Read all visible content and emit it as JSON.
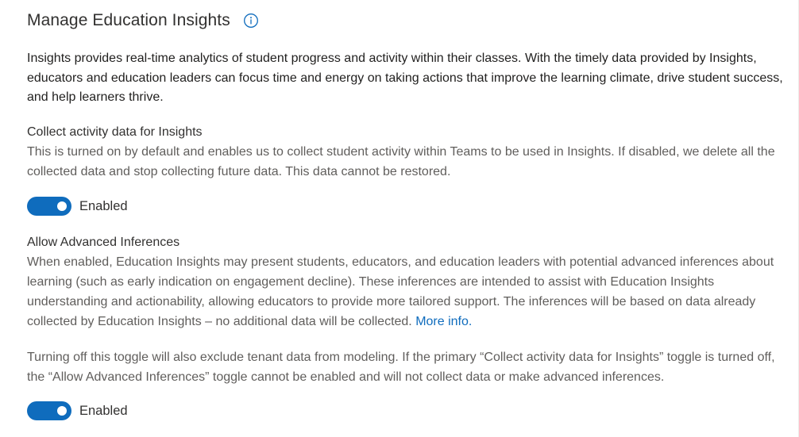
{
  "header": {
    "title": "Manage Education Insights",
    "info_icon": "info-circle-icon"
  },
  "intro": {
    "text": "Insights provides real-time analytics of student progress and activity within their classes. With the timely data provided by Insights, educators and education leaders can focus time and energy on taking actions that improve the learning climate, drive student success, and help learners thrive."
  },
  "collect": {
    "title": "Collect activity data for Insights",
    "description": "This is turned on by default and enables us to collect student activity within Teams to be used in Insights. If disabled, we delete all the collected data and stop collecting future data. This data cannot be restored.",
    "toggle_label": "Enabled",
    "toggle_on": true
  },
  "inferences": {
    "title": "Allow Advanced Inferences",
    "description": "When enabled, Education Insights may present students, educators, and education leaders with potential advanced inferences about learning (such as early indication on engagement decline). These inferences are intended to assist with Education Insights understanding and actionability, allowing educators to provide more tailored support. The inferences will be based on data already collected by Education Insights – no additional data will be collected.",
    "more_info_link": "More info.",
    "note": "Turning off this toggle will also exclude tenant data from modeling. If the primary “Collect activity data for Insights” toggle is turned off, the “Allow Advanced Inferences” toggle cannot be enabled and will not collect data or make advanced inferences.",
    "toggle_label": "Enabled",
    "toggle_on": true
  },
  "colors": {
    "accent": "#0f6cbd",
    "text_primary": "#323130",
    "text_secondary": "#605e5c"
  }
}
